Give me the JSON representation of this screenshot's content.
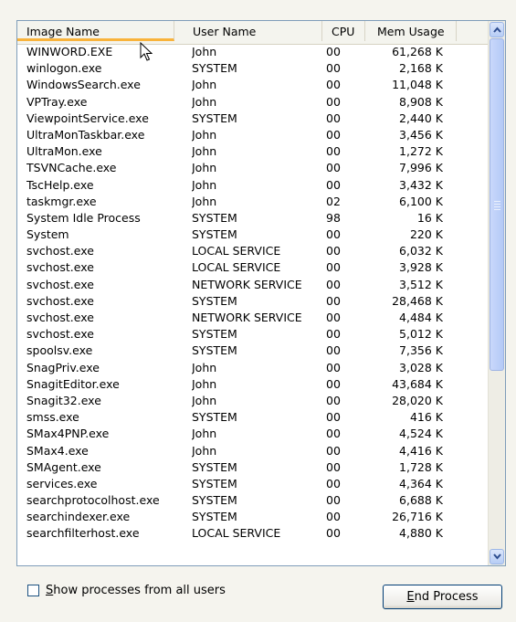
{
  "columns": {
    "image_name": "Image Name",
    "user_name": "User Name",
    "cpu": "CPU",
    "mem_usage": "Mem Usage"
  },
  "sort_column": "image_name",
  "processes": [
    {
      "name": "WINWORD.EXE",
      "user": "John",
      "cpu": "00",
      "mem": "61,268 K"
    },
    {
      "name": "winlogon.exe",
      "user": "SYSTEM",
      "cpu": "00",
      "mem": "2,168 K"
    },
    {
      "name": "WindowsSearch.exe",
      "user": "John",
      "cpu": "00",
      "mem": "11,048 K"
    },
    {
      "name": "VPTray.exe",
      "user": "John",
      "cpu": "00",
      "mem": "8,908 K"
    },
    {
      "name": "ViewpointService.exe",
      "user": "SYSTEM",
      "cpu": "00",
      "mem": "2,440 K"
    },
    {
      "name": "UltraMonTaskbar.exe",
      "user": "John",
      "cpu": "00",
      "mem": "3,456 K"
    },
    {
      "name": "UltraMon.exe",
      "user": "John",
      "cpu": "00",
      "mem": "1,272 K"
    },
    {
      "name": "TSVNCache.exe",
      "user": "John",
      "cpu": "00",
      "mem": "7,996 K"
    },
    {
      "name": "TscHelp.exe",
      "user": "John",
      "cpu": "00",
      "mem": "3,432 K"
    },
    {
      "name": "taskmgr.exe",
      "user": "John",
      "cpu": "02",
      "mem": "6,100 K"
    },
    {
      "name": "System Idle Process",
      "user": "SYSTEM",
      "cpu": "98",
      "mem": "16 K"
    },
    {
      "name": "System",
      "user": "SYSTEM",
      "cpu": "00",
      "mem": "220 K"
    },
    {
      "name": "svchost.exe",
      "user": "LOCAL SERVICE",
      "cpu": "00",
      "mem": "6,032 K"
    },
    {
      "name": "svchost.exe",
      "user": "LOCAL SERVICE",
      "cpu": "00",
      "mem": "3,928 K"
    },
    {
      "name": "svchost.exe",
      "user": "NETWORK SERVICE",
      "cpu": "00",
      "mem": "3,512 K"
    },
    {
      "name": "svchost.exe",
      "user": "SYSTEM",
      "cpu": "00",
      "mem": "28,468 K"
    },
    {
      "name": "svchost.exe",
      "user": "NETWORK SERVICE",
      "cpu": "00",
      "mem": "4,484 K"
    },
    {
      "name": "svchost.exe",
      "user": "SYSTEM",
      "cpu": "00",
      "mem": "5,012 K"
    },
    {
      "name": "spoolsv.exe",
      "user": "SYSTEM",
      "cpu": "00",
      "mem": "7,356 K"
    },
    {
      "name": "SnagPriv.exe",
      "user": "John",
      "cpu": "00",
      "mem": "3,028 K"
    },
    {
      "name": "SnagitEditor.exe",
      "user": "John",
      "cpu": "00",
      "mem": "43,684 K"
    },
    {
      "name": "Snagit32.exe",
      "user": "John",
      "cpu": "00",
      "mem": "28,020 K"
    },
    {
      "name": "smss.exe",
      "user": "SYSTEM",
      "cpu": "00",
      "mem": "416 K"
    },
    {
      "name": "SMax4PNP.exe",
      "user": "John",
      "cpu": "00",
      "mem": "4,524 K"
    },
    {
      "name": "SMax4.exe",
      "user": "John",
      "cpu": "00",
      "mem": "4,416 K"
    },
    {
      "name": "SMAgent.exe",
      "user": "SYSTEM",
      "cpu": "00",
      "mem": "1,728 K"
    },
    {
      "name": "services.exe",
      "user": "SYSTEM",
      "cpu": "00",
      "mem": "4,364 K"
    },
    {
      "name": "searchprotocolhost.exe",
      "user": "SYSTEM",
      "cpu": "00",
      "mem": "6,688 K"
    },
    {
      "name": "searchindexer.exe",
      "user": "SYSTEM",
      "cpu": "00",
      "mem": "26,716 K"
    },
    {
      "name": "searchfilterhost.exe",
      "user": "LOCAL SERVICE",
      "cpu": "00",
      "mem": "4,880 K"
    }
  ],
  "show_all_checkbox": {
    "checked": false,
    "mnemonic": "S",
    "label_rest": "how processes from all users"
  },
  "end_process_button": {
    "mnemonic": "E",
    "label_rest": "nd Process"
  },
  "icons": {
    "scroll_up": "chevron-up-icon",
    "scroll_down": "chevron-down-icon",
    "cursor": "mouse-pointer-icon"
  },
  "colors": {
    "sort_indicator": "#f9b33b",
    "scrollbar": "#b7cdf5",
    "border": "#7f9db9"
  }
}
